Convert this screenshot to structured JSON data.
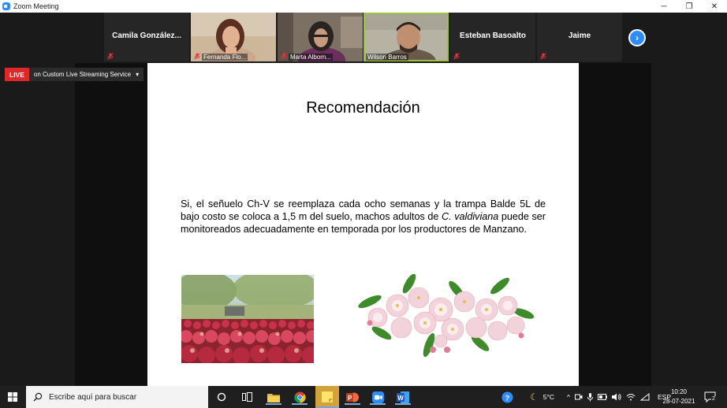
{
  "window": {
    "title": "Zoom Meeting",
    "controls": [
      "minimize",
      "restore",
      "close"
    ]
  },
  "participants": [
    {
      "name": "Camila  González...",
      "video": false,
      "muted": true
    },
    {
      "name": "Fernanda Flo...",
      "video": true,
      "muted": true
    },
    {
      "name": "Marta Alborn...",
      "video": true,
      "muted": true
    },
    {
      "name": "Wilson Barros",
      "video": true,
      "muted": false,
      "active": true
    },
    {
      "name": "Esteban Basoalto",
      "video": false,
      "muted": true
    },
    {
      "name": "Jaime",
      "video": false,
      "muted": true
    }
  ],
  "live": {
    "badge": "LIVE",
    "service": "on Custom Live Streaming Service"
  },
  "slide": {
    "title": "Recomendación",
    "body_parts": {
      "before": "Si,  el señuelo Ch-V se reemplaza cada ocho semanas y la trampa Balde 5L de bajo costo se coloca a 1,5 m del suelo,  machos adultos de ",
      "italic": "C. valdiviana",
      "after": " puede ser monitoreados adecuadamente en temporada por los productores de Manzano."
    }
  },
  "taskbar": {
    "search_placeholder": "Escribe aquí para buscar",
    "pinned": [
      "cortana-icon",
      "task-view-icon",
      "file-explorer-icon",
      "chrome-icon",
      "sticky-notes-icon",
      "powerpoint-icon",
      "zoom-icon",
      "word-icon"
    ],
    "weather": "5°C",
    "language": "ESP",
    "time": "10:20",
    "date": "28-07-2021",
    "notifications": "2"
  },
  "colors": {
    "accent": "#2d8cff",
    "live": "#e02828",
    "active_speaker": "#9bc53d"
  }
}
